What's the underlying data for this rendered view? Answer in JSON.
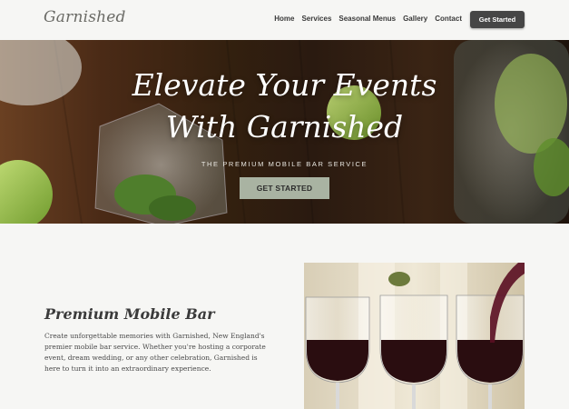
{
  "header": {
    "logo": "Garnished",
    "nav": [
      "Home",
      "Services",
      "Seasonal Menus",
      "Gallery",
      "Contact"
    ],
    "cta": "Get Started"
  },
  "hero": {
    "title_line1": "Elevate Your Events",
    "title_line2": "With Garnished",
    "subtitle": "THE PREMIUM MOBILE BAR SERVICE",
    "button": "GET STARTED"
  },
  "about": {
    "title": "Premium Mobile Bar",
    "text": "Create unforgettable memories with Garnished, New England's premier mobile bar service. Whether you're hosting a corporate event, dream wedding, or any other celebration, Garnished is here to turn it into an extraordinary experience."
  },
  "colors": {
    "background": "#f6f6f4",
    "nav_button": "#464646",
    "hero_button": "#a9b3a2"
  }
}
